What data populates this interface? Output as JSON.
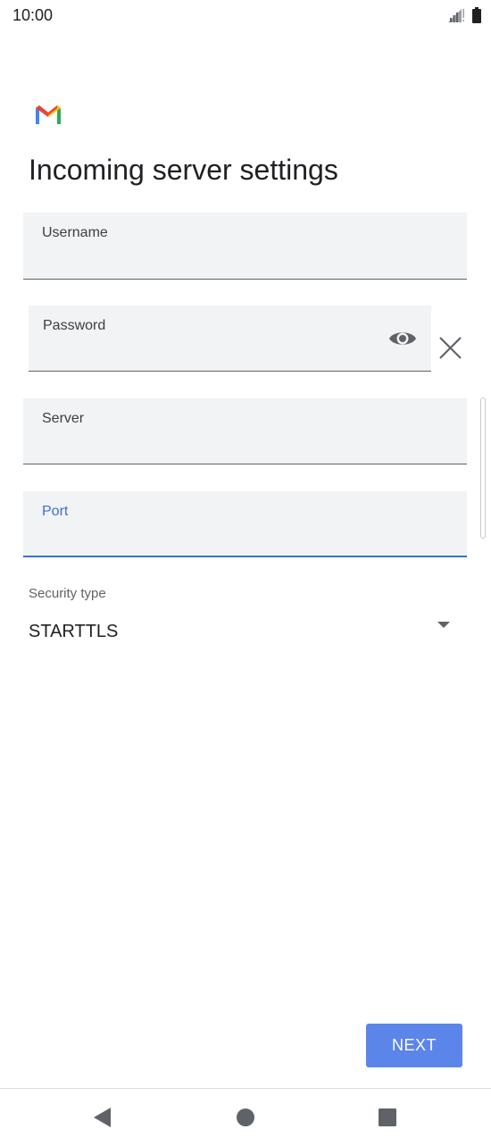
{
  "status_bar": {
    "time": "10:00"
  },
  "page": {
    "title": "Incoming server settings"
  },
  "fields": {
    "username": {
      "label": "Username",
      "value": ""
    },
    "password": {
      "label": "Password",
      "value": ""
    },
    "server": {
      "label": "Server",
      "value": ""
    },
    "port": {
      "label": "Port",
      "value": ""
    }
  },
  "security": {
    "label": "Security type",
    "selected": "STARTTLS"
  },
  "actions": {
    "next_label": "NEXT"
  },
  "icons": {
    "logo": "gmail-logo",
    "password_toggle": "eye-icon",
    "clear": "close-icon",
    "dropdown": "dropdown-arrow-icon",
    "nav_back": "back-triangle-icon",
    "nav_home": "home-circle-icon",
    "nav_recents": "recents-square-icon"
  },
  "colors": {
    "accent": "#3b6fd6",
    "button": "#5b85e8",
    "field_bg": "#f1f3f4"
  }
}
